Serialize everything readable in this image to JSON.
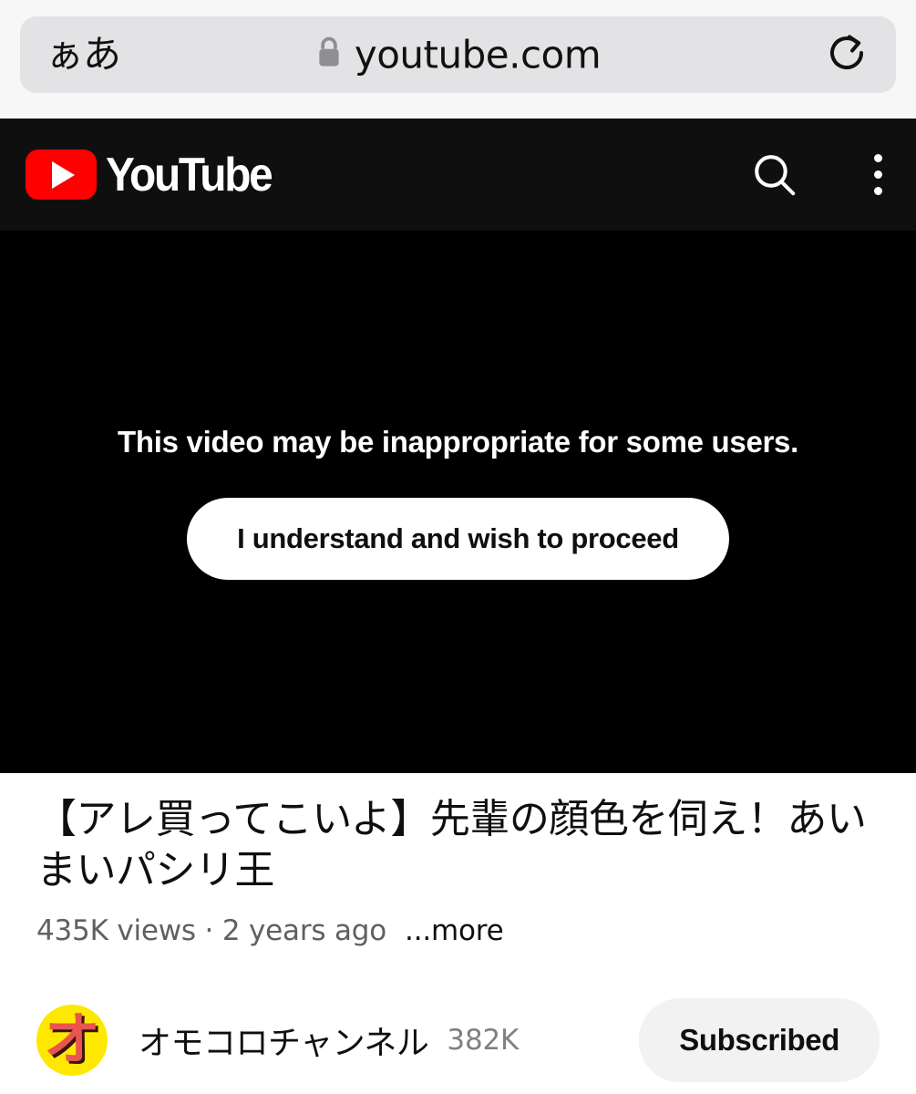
{
  "browser": {
    "text_size_button": "ぁあ",
    "lock_icon": "lock-icon",
    "url": "youtube.com",
    "reload_icon": "reload-icon"
  },
  "yt_header": {
    "brand": "YouTube",
    "search_icon": "search-icon",
    "menu_icon": "kebab-menu-icon"
  },
  "player": {
    "age_gate_message": "This video may be inappropriate for some users.",
    "age_gate_button": "I understand and wish to proceed",
    "background_color": "#000000"
  },
  "video": {
    "title": "【アレ買ってこいよ】先輩の顔色を伺え！あいまいパシリ王",
    "stats": "435K views · 2 years ago",
    "more_label": "...more"
  },
  "channel": {
    "avatar_glyph": "オ",
    "avatar_bg_color": "#ffe800",
    "avatar_glyph_color": "#e8564f",
    "name": "オモコロチャンネル",
    "subscribers": "382K",
    "subscribe_button": "Subscribed"
  },
  "colors": {
    "brand_red": "#ff0000",
    "header_bg": "#0f0f0f",
    "chrome_bg": "#f7f7f7",
    "address_bg": "#e3e3e5",
    "secondary_text": "#606060"
  }
}
